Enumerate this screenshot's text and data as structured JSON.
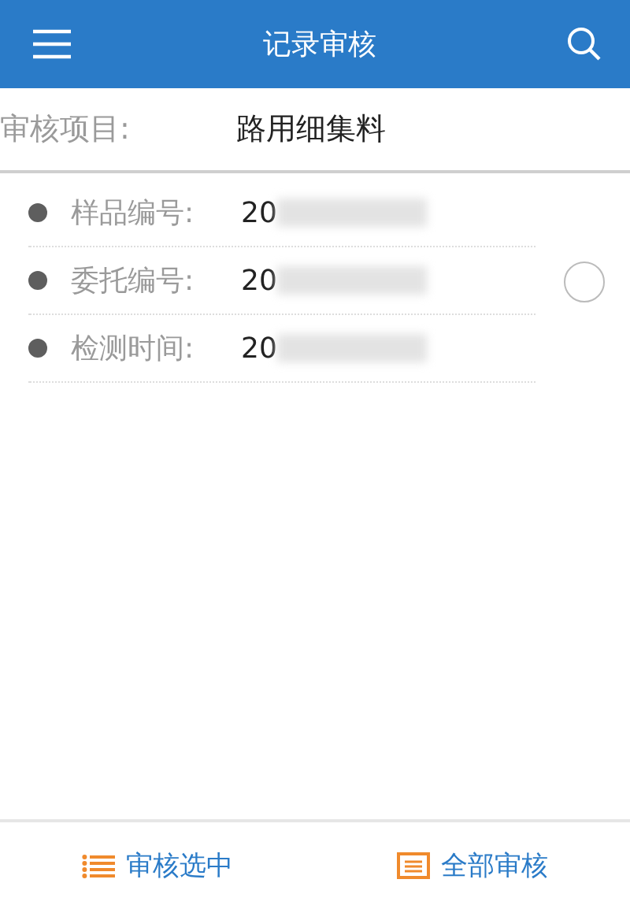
{
  "header": {
    "title": "记录审核"
  },
  "project": {
    "label": "审核项目:",
    "value": "路用细集料"
  },
  "records": [
    {
      "selected": false,
      "fields": [
        {
          "label": "样品编号:",
          "value": "20"
        },
        {
          "label": "委托编号:",
          "value": "20"
        },
        {
          "label": "检测时间:",
          "value": "20"
        }
      ]
    }
  ],
  "footer_buttons": [
    {
      "kind": "list",
      "label": "审核选中"
    },
    {
      "kind": "doc",
      "label": "全部审核"
    }
  ]
}
